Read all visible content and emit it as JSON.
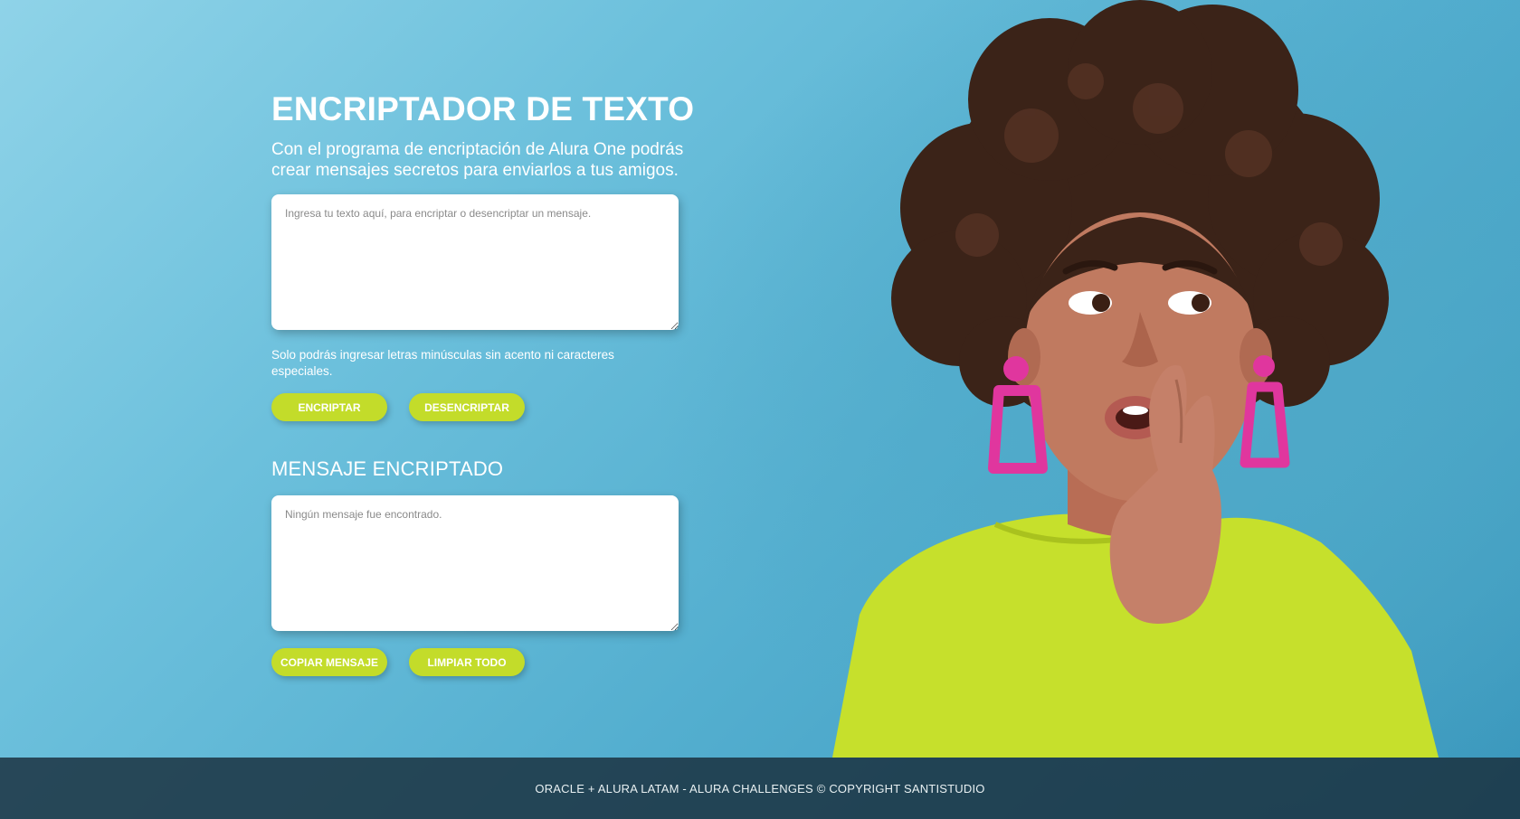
{
  "header": {
    "title": "ENCRIPTADOR DE TEXTO",
    "subtitle": "Con el programa de encriptación de Alura One podrás crear mensajes secretos para enviarlos a tus amigos."
  },
  "input": {
    "placeholder": "Ingresa tu texto aquí, para encriptar o desencriptar un mensaje.",
    "value": ""
  },
  "hint": "Solo podrás ingresar letras minúsculas sin acento ni caracteres especiales.",
  "buttons": {
    "encrypt": "ENCRIPTAR",
    "decrypt": "DESENCRIPTAR",
    "copy": "COPIAR MENSAJE",
    "clear": "LIMPIAR TODO"
  },
  "output": {
    "heading": "MENSAJE ENCRIPTADO",
    "placeholder": "Ningún mensaje fue encontrado.",
    "value": ""
  },
  "footer": {
    "text": "ORACLE + ALURA LATAM - ALURA CHALLENGES © COPYRIGHT SANTISTUDIO"
  },
  "colors": {
    "accent": "#c3dc2a",
    "background": "#5ab4d4",
    "earring": "#e0369e"
  },
  "icons": [
    "woman-whisper-illustration"
  ]
}
